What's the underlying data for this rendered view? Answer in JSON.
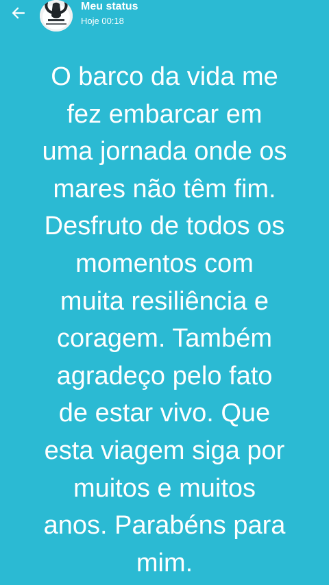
{
  "header": {
    "owner": "Meu status",
    "time": "Hoje 00:18",
    "back_icon": "arrow-left-icon",
    "avatar_icon": "profile-photo-icon"
  },
  "status": {
    "background_color": "#2bbad3",
    "text_color": "#ffffff",
    "lines": [
      "O barco da vida me",
      "fez embarcar em",
      "uma jornada onde os",
      "mares não têm fim.",
      "Desfruto de todos os",
      "momentos com",
      "muita resiliência e",
      "coragem. Também",
      "agradeço pelo fato",
      "de estar vivo. Que",
      "esta viagem siga por",
      "muitos e muitos",
      "anos. Parabéns para",
      "mim."
    ]
  }
}
